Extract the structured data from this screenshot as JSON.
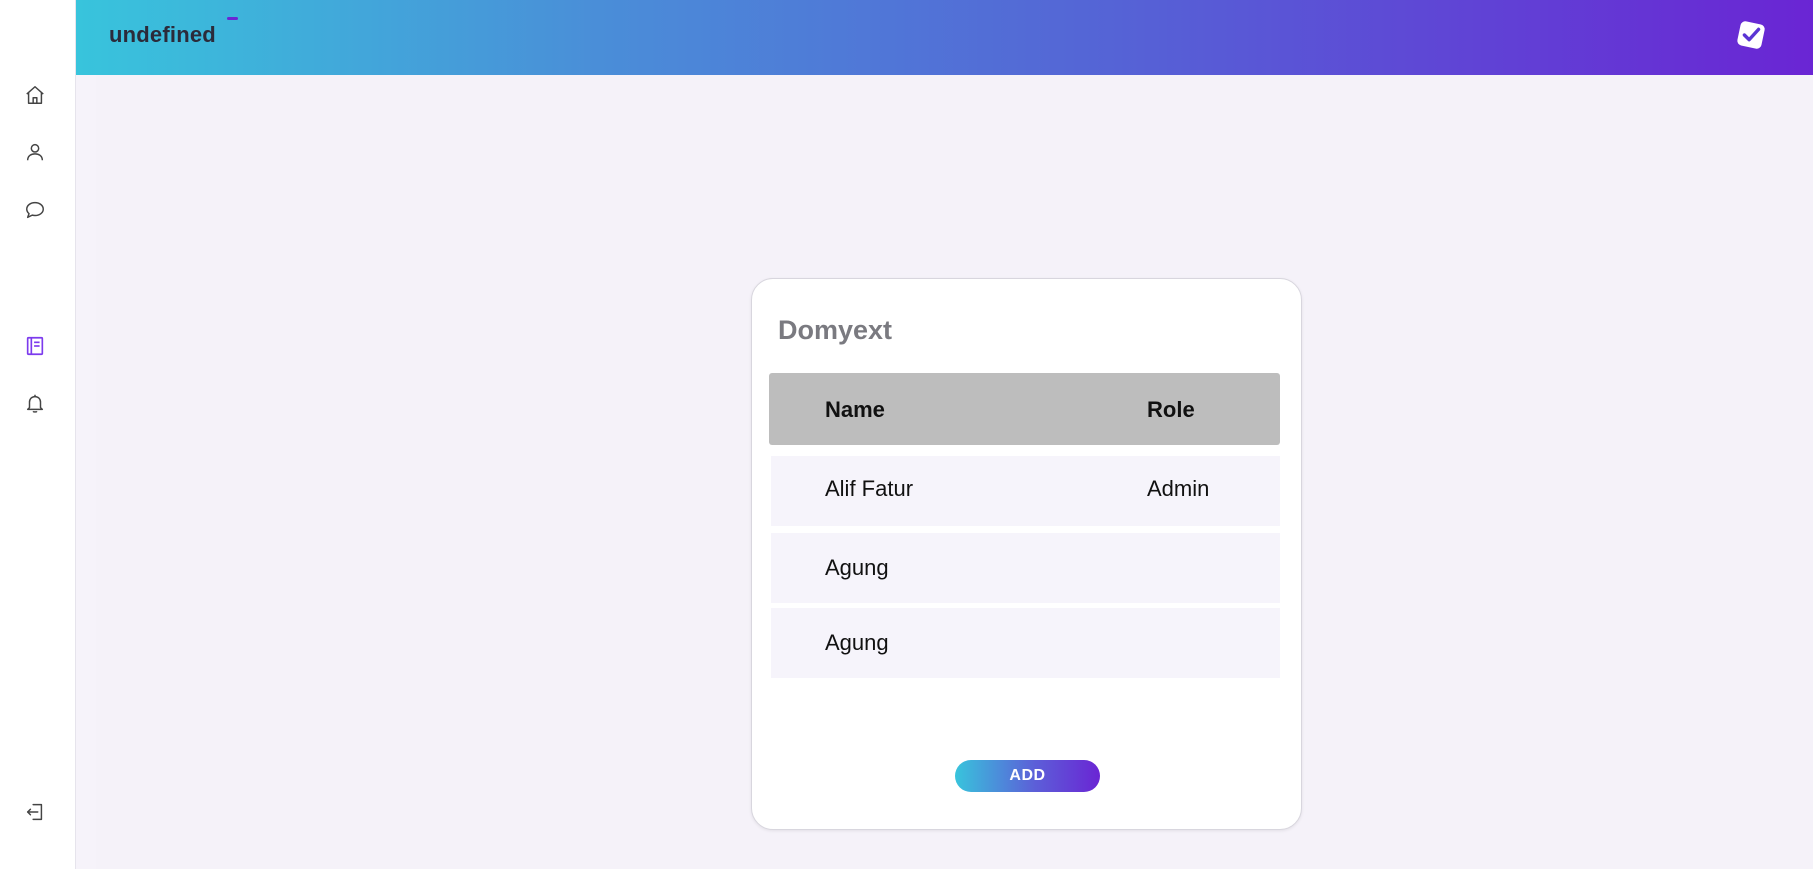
{
  "header": {
    "brand": "undefined",
    "logo_icon": "check-badge-icon"
  },
  "sidebar": {
    "items": [
      {
        "name": "home",
        "icon": "home-icon",
        "active": false
      },
      {
        "name": "profile",
        "icon": "user-icon",
        "active": false
      },
      {
        "name": "chat",
        "icon": "chat-bubble-icon",
        "active": false
      },
      {
        "name": "notes",
        "icon": "notebook-icon",
        "active": true
      },
      {
        "name": "notifications",
        "icon": "bell-icon",
        "active": false
      },
      {
        "name": "logout",
        "icon": "logout-icon",
        "active": false
      }
    ],
    "active_color": "#7c3aed",
    "icon_color": "#444444"
  },
  "card": {
    "title": "Domyext",
    "columns": [
      "Name",
      "Role"
    ],
    "rows": [
      {
        "name": "Alif Fatur",
        "role": "Admin"
      },
      {
        "name": "Agung",
        "role": ""
      },
      {
        "name": "Agung",
        "role": ""
      }
    ],
    "add_label": "ADD"
  },
  "colors": {
    "gradient_start": "#38c4dc",
    "gradient_end": "#6a25d4",
    "background": "#f5f2f9",
    "table_header": "#bdbdbd"
  }
}
